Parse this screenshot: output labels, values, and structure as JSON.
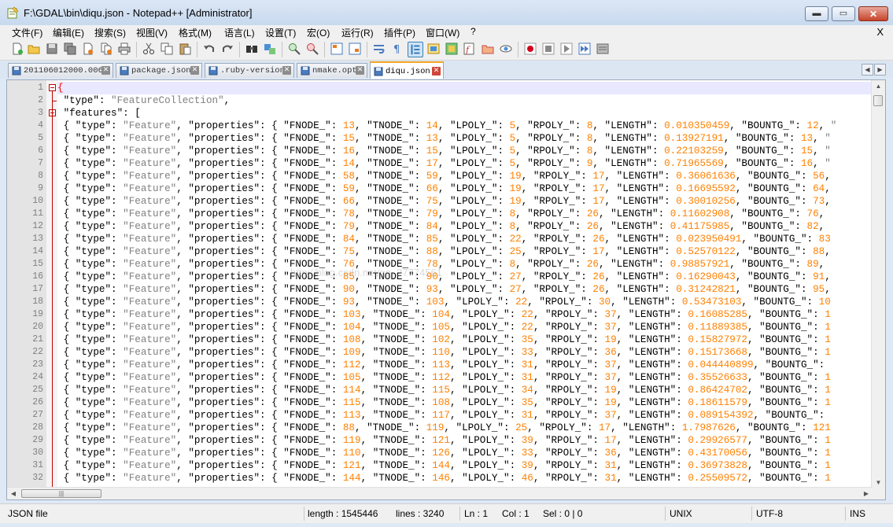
{
  "window": {
    "title": "F:\\GDAL\\bin\\diqu.json - Notepad++ [Administrator]",
    "minimize": "▬",
    "maximize": "▭",
    "close": "✕"
  },
  "menu": {
    "items": [
      "文件(F)",
      "编辑(E)",
      "搜索(S)",
      "视图(V)",
      "格式(M)",
      "语言(L)",
      "设置(T)",
      "宏(O)",
      "运行(R)",
      "插件(P)",
      "窗口(W)",
      "?"
    ],
    "close_doc": "X"
  },
  "toolbar": {
    "icons": [
      "new-file-icon",
      "open-file-icon",
      "save-icon",
      "save-all-icon",
      "close-icon",
      "close-all-icon",
      "print-icon",
      "cut-icon",
      "copy-icon",
      "paste-icon",
      "undo-icon",
      "redo-icon",
      "find-icon",
      "replace-icon",
      "zoom-in-icon",
      "zoom-out-icon",
      "sync-vertical-icon",
      "sync-horizontal-icon",
      "word-wrap-icon",
      "show-all-chars-icon",
      "indent-guide-icon",
      "language-icon",
      "doc-map-icon",
      "function-list-icon",
      "folder-icon",
      "monitor-icon",
      "record-macro-icon",
      "stop-macro-icon",
      "play-macro-icon",
      "run-macro-multiple-icon",
      "save-macro-icon"
    ],
    "pressed_icon": "indent-guide-icon"
  },
  "tabs": [
    {
      "label": "201106012000.006",
      "active": false
    },
    {
      "label": "package.json",
      "active": false
    },
    {
      "label": ".ruby-version",
      "active": false
    },
    {
      "label": "nmake.opt",
      "active": false
    },
    {
      "label": "diqu.json",
      "active": true
    }
  ],
  "editor": {
    "watermark": "http://blog.csdn.net/qq_27774561",
    "lines": [
      {
        "num": "1",
        "text": "{"
      },
      {
        "num": "2",
        "text": "\"type\": \"FeatureCollection\","
      },
      {
        "num": "3",
        "text": "\"features\": ["
      },
      {
        "num": "4",
        "text": "{ \"type\": \"Feature\", \"properties\": { \"FNODE_\": 13, \"TNODE_\": 14, \"LPOLY_\": 5, \"RPOLY_\": 8, \"LENGTH\": 0.010350459, \"BOUNTG_\": 12, \""
      },
      {
        "num": "5",
        "text": "{ \"type\": \"Feature\", \"properties\": { \"FNODE_\": 15, \"TNODE_\": 13, \"LPOLY_\": 5, \"RPOLY_\": 8, \"LENGTH\": 0.13927191, \"BOUNTG_\": 13, \""
      },
      {
        "num": "6",
        "text": "{ \"type\": \"Feature\", \"properties\": { \"FNODE_\": 16, \"TNODE_\": 15, \"LPOLY_\": 5, \"RPOLY_\": 8, \"LENGTH\": 0.22103259, \"BOUNTG_\": 15, \""
      },
      {
        "num": "7",
        "text": "{ \"type\": \"Feature\", \"properties\": { \"FNODE_\": 14, \"TNODE_\": 17, \"LPOLY_\": 5, \"RPOLY_\": 9, \"LENGTH\": 0.71965569, \"BOUNTG_\": 16, \""
      },
      {
        "num": "8",
        "text": "{ \"type\": \"Feature\", \"properties\": { \"FNODE_\": 58, \"TNODE_\": 59, \"LPOLY_\": 19, \"RPOLY_\": 17, \"LENGTH\": 0.36061636, \"BOUNTG_\": 56,"
      },
      {
        "num": "9",
        "text": "{ \"type\": \"Feature\", \"properties\": { \"FNODE_\": 59, \"TNODE_\": 66, \"LPOLY_\": 19, \"RPOLY_\": 17, \"LENGTH\": 0.16695592, \"BOUNTG_\": 64,"
      },
      {
        "num": "10",
        "text": "{ \"type\": \"Feature\", \"properties\": { \"FNODE_\": 66, \"TNODE_\": 75, \"LPOLY_\": 19, \"RPOLY_\": 17, \"LENGTH\": 0.30010256, \"BOUNTG_\": 73,"
      },
      {
        "num": "11",
        "text": "{ \"type\": \"Feature\", \"properties\": { \"FNODE_\": 78, \"TNODE_\": 79, \"LPOLY_\": 8, \"RPOLY_\": 26, \"LENGTH\": 0.11602908, \"BOUNTG_\": 76,"
      },
      {
        "num": "12",
        "text": "{ \"type\": \"Feature\", \"properties\": { \"FNODE_\": 79, \"TNODE_\": 84, \"LPOLY_\": 8, \"RPOLY_\": 26, \"LENGTH\": 0.41175985, \"BOUNTG_\": 82,"
      },
      {
        "num": "13",
        "text": "{ \"type\": \"Feature\", \"properties\": { \"FNODE_\": 84, \"TNODE_\": 85, \"LPOLY_\": 22, \"RPOLY_\": 26, \"LENGTH\": 0.023950491, \"BOUNTG_\": 83"
      },
      {
        "num": "14",
        "text": "{ \"type\": \"Feature\", \"properties\": { \"FNODE_\": 75, \"TNODE_\": 88, \"LPOLY_\": 25, \"RPOLY_\": 17, \"LENGTH\": 0.52570122, \"BOUNTG_\": 88,"
      },
      {
        "num": "15",
        "text": "{ \"type\": \"Feature\", \"properties\": { \"FNODE_\": 76, \"TNODE_\": 78, \"LPOLY_\": 8, \"RPOLY_\": 26, \"LENGTH\": 0.98857921, \"BOUNTG_\": 89,"
      },
      {
        "num": "16",
        "text": "{ \"type\": \"Feature\", \"properties\": { \"FNODE_\": 85, \"TNODE_\": 90, \"LPOLY_\": 27, \"RPOLY_\": 26, \"LENGTH\": 0.16290043, \"BOUNTG_\": 91,"
      },
      {
        "num": "17",
        "text": "{ \"type\": \"Feature\", \"properties\": { \"FNODE_\": 90, \"TNODE_\": 93, \"LPOLY_\": 27, \"RPOLY_\": 26, \"LENGTH\": 0.31242821, \"BOUNTG_\": 95,"
      },
      {
        "num": "18",
        "text": "{ \"type\": \"Feature\", \"properties\": { \"FNODE_\": 93, \"TNODE_\": 103, \"LPOLY_\": 22, \"RPOLY_\": 30, \"LENGTH\": 0.53473103, \"BOUNTG_\": 10"
      },
      {
        "num": "19",
        "text": "{ \"type\": \"Feature\", \"properties\": { \"FNODE_\": 103, \"TNODE_\": 104, \"LPOLY_\": 22, \"RPOLY_\": 37, \"LENGTH\": 0.16085285, \"BOUNTG_\": 1"
      },
      {
        "num": "20",
        "text": "{ \"type\": \"Feature\", \"properties\": { \"FNODE_\": 104, \"TNODE_\": 105, \"LPOLY_\": 22, \"RPOLY_\": 37, \"LENGTH\": 0.11889385, \"BOUNTG_\": 1"
      },
      {
        "num": "21",
        "text": "{ \"type\": \"Feature\", \"properties\": { \"FNODE_\": 108, \"TNODE_\": 102, \"LPOLY_\": 35, \"RPOLY_\": 19, \"LENGTH\": 0.15827972, \"BOUNTG_\": 1"
      },
      {
        "num": "22",
        "text": "{ \"type\": \"Feature\", \"properties\": { \"FNODE_\": 109, \"TNODE_\": 110, \"LPOLY_\": 33, \"RPOLY_\": 36, \"LENGTH\": 0.15173668, \"BOUNTG_\": 1"
      },
      {
        "num": "23",
        "text": "{ \"type\": \"Feature\", \"properties\": { \"FNODE_\": 112, \"TNODE_\": 113, \"LPOLY_\": 31, \"RPOLY_\": 37, \"LENGTH\": 0.044440899, \"BOUNTG_\":"
      },
      {
        "num": "24",
        "text": "{ \"type\": \"Feature\", \"properties\": { \"FNODE_\": 105, \"TNODE_\": 112, \"LPOLY_\": 31, \"RPOLY_\": 37, \"LENGTH\": 0.35526633, \"BOUNTG_\": 1"
      },
      {
        "num": "25",
        "text": "{ \"type\": \"Feature\", \"properties\": { \"FNODE_\": 114, \"TNODE_\": 115, \"LPOLY_\": 34, \"RPOLY_\": 19, \"LENGTH\": 0.86424702, \"BOUNTG_\": 1"
      },
      {
        "num": "26",
        "text": "{ \"type\": \"Feature\", \"properties\": { \"FNODE_\": 115, \"TNODE_\": 108, \"LPOLY_\": 35, \"RPOLY_\": 19, \"LENGTH\": 0.18611579, \"BOUNTG_\": 1"
      },
      {
        "num": "27",
        "text": "{ \"type\": \"Feature\", \"properties\": { \"FNODE_\": 113, \"TNODE_\": 117, \"LPOLY_\": 31, \"RPOLY_\": 37, \"LENGTH\": 0.089154392, \"BOUNTG_\":"
      },
      {
        "num": "28",
        "text": "{ \"type\": \"Feature\", \"properties\": { \"FNODE_\": 88, \"TNODE_\": 119, \"LPOLY_\": 25, \"RPOLY_\": 17, \"LENGTH\": 1.7987626, \"BOUNTG_\": 121"
      },
      {
        "num": "29",
        "text": "{ \"type\": \"Feature\", \"properties\": { \"FNODE_\": 119, \"TNODE_\": 121, \"LPOLY_\": 39, \"RPOLY_\": 17, \"LENGTH\": 0.29926577, \"BOUNTG_\": 1"
      },
      {
        "num": "30",
        "text": "{ \"type\": \"Feature\", \"properties\": { \"FNODE_\": 110, \"TNODE_\": 126, \"LPOLY_\": 33, \"RPOLY_\": 36, \"LENGTH\": 0.43170056, \"BOUNTG_\": 1"
      },
      {
        "num": "31",
        "text": "{ \"type\": \"Feature\", \"properties\": { \"FNODE_\": 121, \"TNODE_\": 144, \"LPOLY_\": 39, \"RPOLY_\": 31, \"LENGTH\": 0.36973828, \"BOUNTG_\": 1"
      },
      {
        "num": "32",
        "text": "{ \"type\": \"Feature\", \"properties\": { \"FNODE_\": 144, \"TNODE_\": 146, \"LPOLY_\": 46, \"RPOLY_\": 31, \"LENGTH\": 0.25509572, \"BOUNTG_\": 1"
      }
    ]
  },
  "status": {
    "file_type": "JSON file",
    "length": "length : 1545446",
    "lines": "lines : 3240",
    "ln": "Ln : 1",
    "col": "Col : 1",
    "sel": "Sel : 0 | 0",
    "eol": "UNIX",
    "encoding": "UTF-8",
    "mode": "INS"
  },
  "colors": {
    "number": "#ff8000",
    "string": "#808080",
    "fold_marker": "#c00000",
    "active_tab_accent": "#f5a623"
  }
}
